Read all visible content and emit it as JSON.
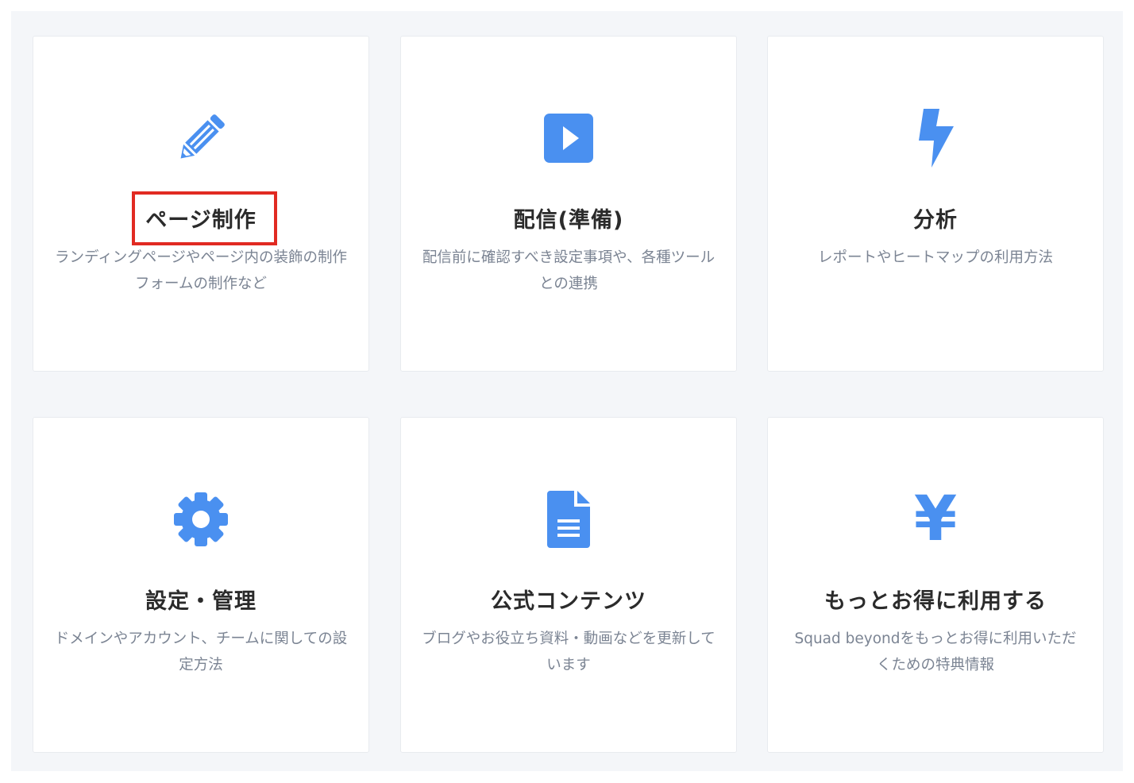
{
  "accent_color": "#4a90f0",
  "highlight_color": "#e12a22",
  "cards": [
    {
      "icon": "pencil-icon",
      "title": "ページ制作",
      "description": "ランディングページやページ内の装飾の制作 フォームの制作など",
      "highlighted": true
    },
    {
      "icon": "play-square-icon",
      "title": "配信(準備)",
      "description": "配信前に確認すべき設定事項や、各種ツールとの連携"
    },
    {
      "icon": "lightning-bolt-icon",
      "title": "分析",
      "description": "レポートやヒートマップの利用方法"
    },
    {
      "icon": "gear-icon",
      "title": "設定・管理",
      "description": "ドメインやアカウント、チームに関しての設定方法"
    },
    {
      "icon": "document-icon",
      "title": "公式コンテンツ",
      "description": "ブログやお役立ち資料・動画などを更新しています"
    },
    {
      "icon": "yen-icon",
      "icon_glyph": "¥",
      "title": "もっとお得に利用する",
      "description": "Squad beyondをもっとお得に利用いただくための特典情報"
    }
  ]
}
